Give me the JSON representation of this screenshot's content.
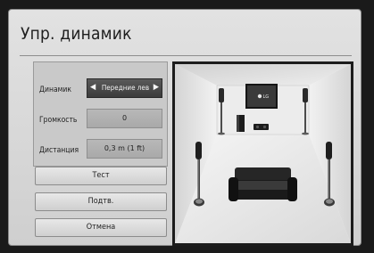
{
  "dialog": {
    "title": "Упр. динамик",
    "rows": {
      "speaker": {
        "label": "Динамик",
        "value": "Передние лев"
      },
      "volume": {
        "label": "Громкость",
        "value": "0"
      },
      "distance": {
        "label": "Дистанция",
        "value": "0,3 m (1 ft)"
      }
    },
    "buttons": {
      "test": "Тест",
      "confirm": "Подтв.",
      "cancel": "Отмена"
    },
    "tv_logo": "LG"
  }
}
